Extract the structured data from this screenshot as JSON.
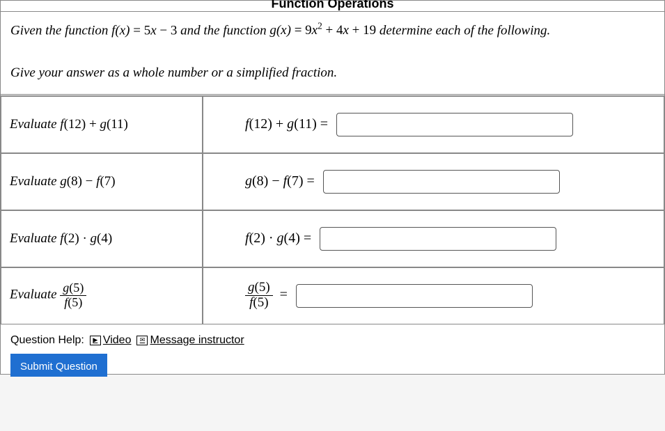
{
  "title": "Function Operations",
  "prompt_prefix": "Given the function ",
  "f_def_lhs": "f(x)",
  "f_def_rhs": "5x − 3",
  "prompt_mid": " and the function ",
  "g_def_lhs": "g(x)",
  "g_def_rhs": "9x² + 4x + 19",
  "prompt_suffix": " determine each of the following.",
  "instruction": "Give your answer as a whole number or a simplified fraction.",
  "rows": [
    {
      "left_prefix": "Evaluate ",
      "left_expr": "f(12) + g(11)",
      "right_expr": "f(12) + g(11) =",
      "value": ""
    },
    {
      "left_prefix": "Evaluate ",
      "left_expr": "g(8) − f(7)",
      "right_expr": "g(8) − f(7) =",
      "value": ""
    },
    {
      "left_prefix": "Evaluate ",
      "left_expr": "f(2) · g(4)",
      "right_expr": "f(2) · g(4) =",
      "value": ""
    },
    {
      "left_prefix": "Evaluate ",
      "frac_num": "g(5)",
      "frac_den": "f(5)",
      "right_frac_num": "g(5)",
      "right_frac_den": "f(5)",
      "value": ""
    }
  ],
  "help_label": "Question Help:",
  "video_label": "Video",
  "message_label": "Message instructor",
  "submit_label": "Submit Question"
}
